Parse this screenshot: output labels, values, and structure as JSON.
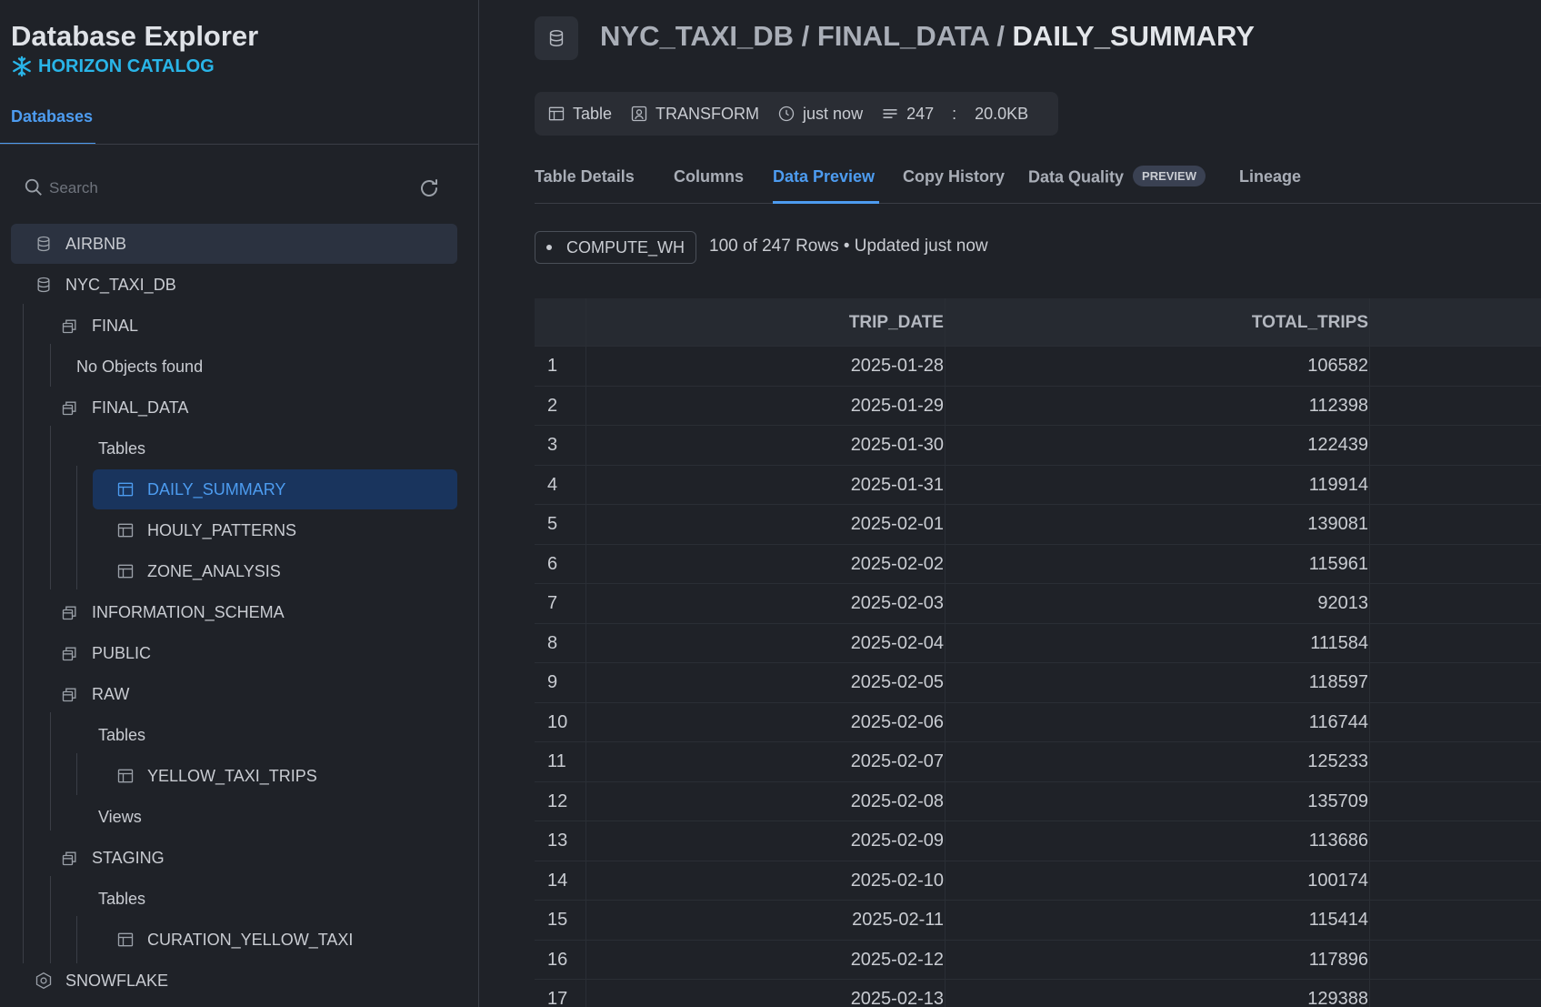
{
  "sidebar": {
    "title": "Database Explorer",
    "catalog": "HORIZON CATALOG",
    "tab": "Databases",
    "search_placeholder": "Search",
    "tree": [
      {
        "label": "AIRBNB"
      },
      {
        "label": "NYC_TAXI_DB"
      },
      {
        "label": "FINAL"
      },
      {
        "label": "No Objects found"
      },
      {
        "label": "FINAL_DATA"
      },
      {
        "label": "Tables"
      },
      {
        "label": "DAILY_SUMMARY"
      },
      {
        "label": "HOULY_PATTERNS"
      },
      {
        "label": "ZONE_ANALYSIS"
      },
      {
        "label": "INFORMATION_SCHEMA"
      },
      {
        "label": "PUBLIC"
      },
      {
        "label": "RAW"
      },
      {
        "label": "Tables"
      },
      {
        "label": "YELLOW_TAXI_TRIPS"
      },
      {
        "label": "Views"
      },
      {
        "label": "STAGING"
      },
      {
        "label": "Tables"
      },
      {
        "label": "CURATION_YELLOW_TAXI"
      },
      {
        "label": "SNOWFLAKE"
      }
    ]
  },
  "header": {
    "crumb_prefix": "NYC_TAXI_DB / FINAL_DATA / ",
    "crumb_current": "DAILY_SUMMARY"
  },
  "meta": {
    "type": "Table",
    "owner": "TRANSFORM",
    "updated": "just now",
    "rows": "247",
    "sep": ":",
    "size": "20.0KB"
  },
  "tabs": {
    "details": "Table Details",
    "columns": "Columns",
    "preview": "Data Preview",
    "history": "Copy History",
    "quality": "Data Quality",
    "quality_badge": "PREVIEW",
    "lineage": "Lineage"
  },
  "preview": {
    "warehouse": "COMPUTE_WH",
    "rows_info": "100 of 247 Rows • Updated just now",
    "columns": [
      "TRIP_DATE",
      "TOTAL_TRIPS"
    ],
    "rows": [
      [
        "1",
        "2025-01-28",
        "106582"
      ],
      [
        "2",
        "2025-01-29",
        "112398"
      ],
      [
        "3",
        "2025-01-30",
        "122439"
      ],
      [
        "4",
        "2025-01-31",
        "119914"
      ],
      [
        "5",
        "2025-02-01",
        "139081"
      ],
      [
        "6",
        "2025-02-02",
        "115961"
      ],
      [
        "7",
        "2025-02-03",
        "92013"
      ],
      [
        "8",
        "2025-02-04",
        "111584"
      ],
      [
        "9",
        "2025-02-05",
        "118597"
      ],
      [
        "10",
        "2025-02-06",
        "116744"
      ],
      [
        "11",
        "2025-02-07",
        "125233"
      ],
      [
        "12",
        "2025-02-08",
        "135709"
      ],
      [
        "13",
        "2025-02-09",
        "113686"
      ],
      [
        "14",
        "2025-02-10",
        "100174"
      ],
      [
        "15",
        "2025-02-11",
        "115414"
      ],
      [
        "16",
        "2025-02-12",
        "117896"
      ],
      [
        "17",
        "2025-02-13",
        "129388"
      ]
    ]
  }
}
